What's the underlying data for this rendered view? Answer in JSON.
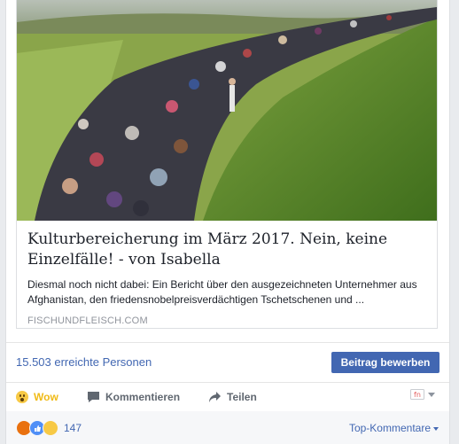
{
  "link_card": {
    "image_icon": "crowd-photo",
    "title": "Kulturbereicherung im März 2017. Nein, keine Einzelfälle! - von Isabella",
    "description": "Diesmal noch nicht dabei: Ein Bericht über den ausgezeichneten Unternehmer aus Afghanistan, den friedensnobelpreisverdächtigen Tschetschenen und ...",
    "domain": "FISCHUNDFLEISCH.COM"
  },
  "reach": {
    "text": "15.503 erreichte Personen",
    "boost_label": "Beitrag bewerben"
  },
  "actions": {
    "reaction_label": "Wow",
    "comment_label": "Kommentieren",
    "share_label": "Teilen"
  },
  "reactions": {
    "count": "147",
    "sort_label": "Top-Kommentare"
  },
  "colors": {
    "link": "#4267b2",
    "wow": "#f0ba15",
    "button_bg": "#4267b2"
  }
}
